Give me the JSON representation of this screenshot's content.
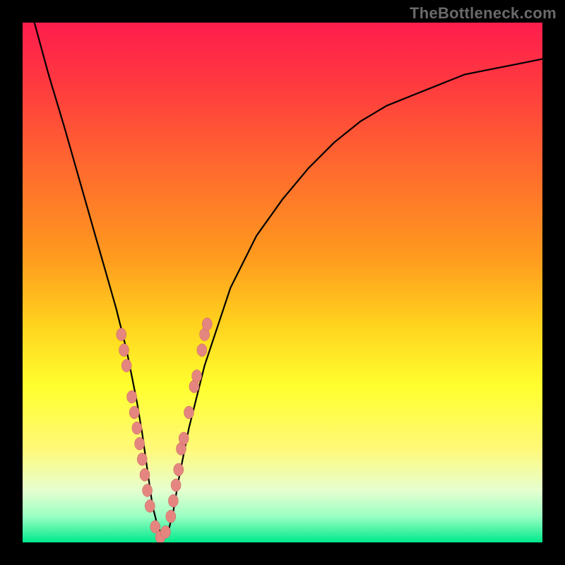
{
  "watermark": "TheBottleneck.com",
  "colors": {
    "bg": "#000000",
    "curve": "#000000",
    "marker_fill": "#e4867f",
    "marker_stroke": "#c9645f",
    "gradient_stops": [
      {
        "offset": 0.0,
        "color": "#ff1d4d"
      },
      {
        "offset": 0.12,
        "color": "#ff3a3f"
      },
      {
        "offset": 0.28,
        "color": "#ff6a2e"
      },
      {
        "offset": 0.45,
        "color": "#ff9a1e"
      },
      {
        "offset": 0.58,
        "color": "#ffd21e"
      },
      {
        "offset": 0.7,
        "color": "#ffff2e"
      },
      {
        "offset": 0.82,
        "color": "#fff978"
      },
      {
        "offset": 0.9,
        "color": "#e6ffd0"
      },
      {
        "offset": 0.95,
        "color": "#9affc2"
      },
      {
        "offset": 1.0,
        "color": "#00e98c"
      }
    ]
  },
  "chart_data": {
    "type": "line",
    "title": "",
    "xlabel": "",
    "ylabel": "",
    "xlim": [
      0,
      100
    ],
    "ylim": [
      0,
      100
    ],
    "grid": false,
    "legend": false,
    "series": [
      {
        "name": "bottleneck-curve",
        "x": [
          0,
          2,
          5,
          8,
          10,
          12,
          14,
          16,
          18,
          20,
          21,
          22,
          23,
          24,
          25,
          26,
          27,
          28,
          29,
          30,
          32,
          35,
          40,
          45,
          50,
          55,
          60,
          65,
          70,
          75,
          80,
          85,
          90,
          95,
          100
        ],
        "y": [
          110,
          101,
          90,
          80,
          73,
          66,
          59,
          52,
          45,
          37,
          32,
          27,
          21,
          14,
          7,
          3,
          1,
          2,
          6,
          12,
          22,
          34,
          49,
          59,
          66,
          72,
          77,
          81,
          84,
          86,
          88,
          90,
          91,
          92,
          93
        ]
      }
    ],
    "markers": [
      {
        "name": "left-branch-point",
        "x": 19.0,
        "y": 40
      },
      {
        "name": "left-branch-point",
        "x": 19.5,
        "y": 37
      },
      {
        "name": "left-branch-point",
        "x": 20.0,
        "y": 34
      },
      {
        "name": "left-branch-point",
        "x": 21.0,
        "y": 28
      },
      {
        "name": "left-branch-point",
        "x": 21.5,
        "y": 25
      },
      {
        "name": "left-branch-point",
        "x": 22.0,
        "y": 22
      },
      {
        "name": "left-branch-point",
        "x": 22.5,
        "y": 19
      },
      {
        "name": "left-branch-point",
        "x": 23.0,
        "y": 16
      },
      {
        "name": "left-branch-point",
        "x": 23.5,
        "y": 13
      },
      {
        "name": "left-branch-point",
        "x": 24.0,
        "y": 10
      },
      {
        "name": "left-branch-point",
        "x": 24.5,
        "y": 7
      },
      {
        "name": "valley-point",
        "x": 25.5,
        "y": 3
      },
      {
        "name": "valley-point",
        "x": 26.5,
        "y": 1
      },
      {
        "name": "valley-point",
        "x": 27.5,
        "y": 2
      },
      {
        "name": "right-branch-point",
        "x": 28.5,
        "y": 5
      },
      {
        "name": "right-branch-point",
        "x": 29.0,
        "y": 8
      },
      {
        "name": "right-branch-point",
        "x": 29.5,
        "y": 11
      },
      {
        "name": "right-branch-point",
        "x": 30.0,
        "y": 14
      },
      {
        "name": "right-branch-point",
        "x": 30.5,
        "y": 18
      },
      {
        "name": "right-branch-point",
        "x": 31.0,
        "y": 20
      },
      {
        "name": "right-branch-point",
        "x": 32.0,
        "y": 25
      },
      {
        "name": "right-branch-point",
        "x": 33.0,
        "y": 30
      },
      {
        "name": "right-branch-point",
        "x": 33.5,
        "y": 32
      },
      {
        "name": "right-branch-point",
        "x": 34.5,
        "y": 37
      },
      {
        "name": "right-branch-point",
        "x": 35.0,
        "y": 40
      },
      {
        "name": "right-branch-point",
        "x": 35.5,
        "y": 42
      }
    ]
  }
}
